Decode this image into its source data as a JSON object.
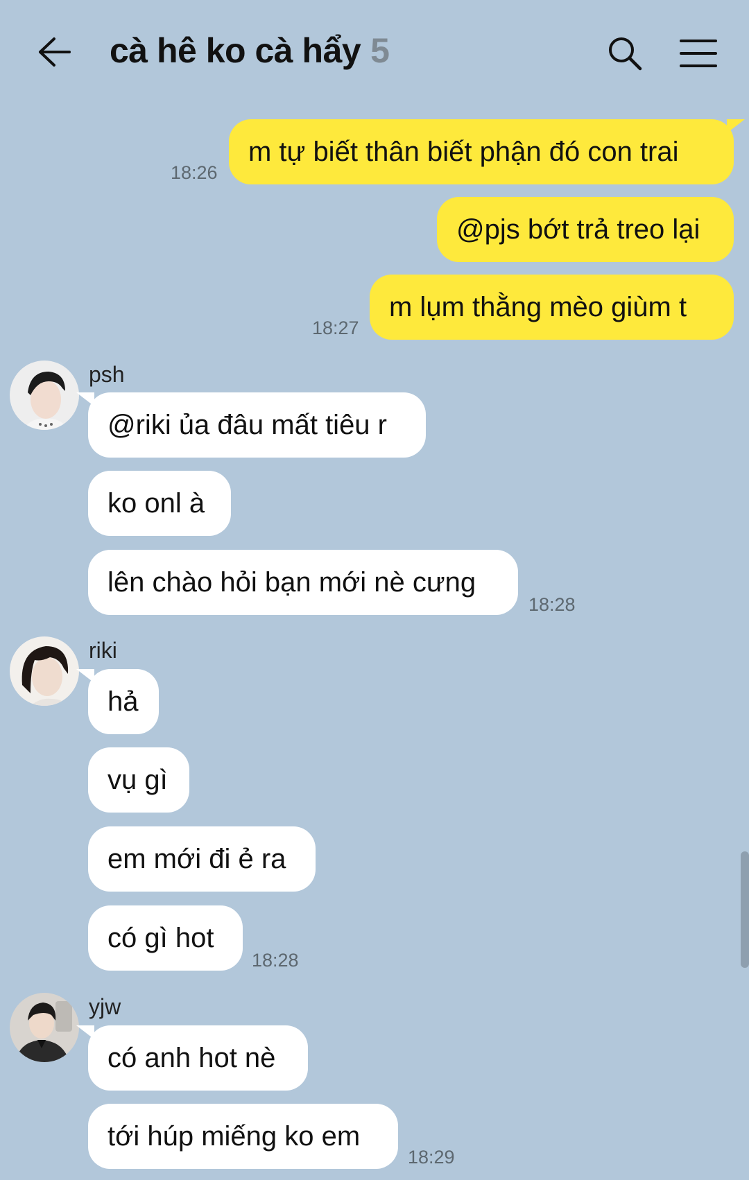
{
  "header": {
    "title": "cà hê ko cà hẩy",
    "member_count": "5",
    "back_icon": "arrow-left-icon",
    "search_icon": "search-icon",
    "menu_icon": "hamburger-menu-icon"
  },
  "colors": {
    "background": "#b2c7da",
    "outgoing_bubble": "#fee93c",
    "incoming_bubble": "#ffffff",
    "timestamp": "#5d6870",
    "member_count": "#7f8a93"
  },
  "outgoing": [
    {
      "text": "m tự biết thân biết phận đó con trai",
      "time": "18:26"
    },
    {
      "text": "@pjs bớt trả treo lại",
      "time": ""
    },
    {
      "text": "m lụm thằng mèo giùm t",
      "time": "18:27"
    }
  ],
  "groups": [
    {
      "sender": "psh",
      "messages": [
        "@riki ủa đâu mất tiêu r",
        "ko onl à",
        "lên chào hỏi bạn mới nè cưng"
      ],
      "time": "18:28"
    },
    {
      "sender": "riki",
      "messages": [
        "hả",
        "vụ gì",
        "em mới đi ẻ ra",
        "có gì hot"
      ],
      "time": "18:28"
    },
    {
      "sender": "yjw",
      "messages": [
        "có anh hot nè",
        "tới húp miếng ko em"
      ],
      "time": "18:29"
    }
  ]
}
